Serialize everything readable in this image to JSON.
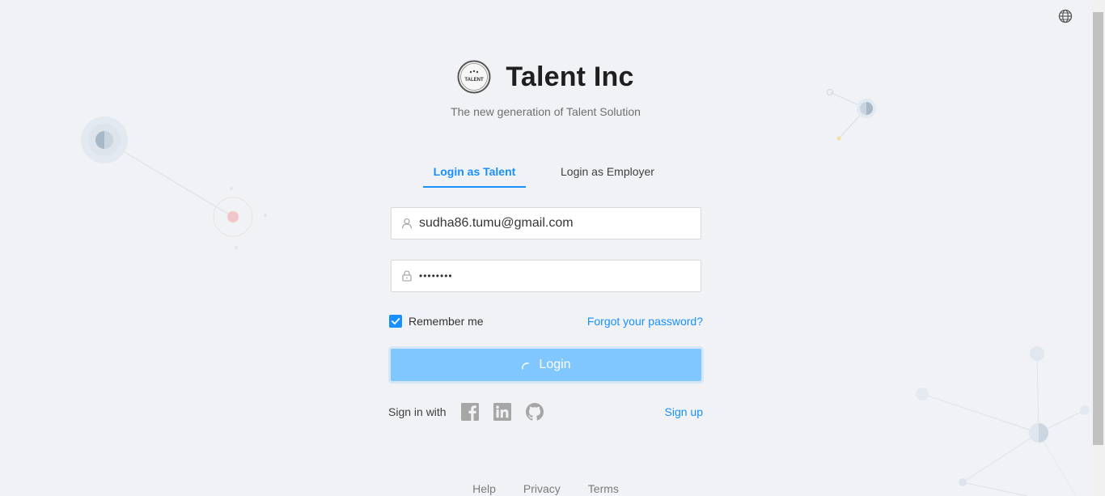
{
  "header": {
    "title": "Talent Inc",
    "subtitle": "The new generation of Talent Solution",
    "logo_text": "TALENT"
  },
  "tabs": [
    {
      "label": "Login as Talent",
      "active": true
    },
    {
      "label": "Login as Employer",
      "active": false
    }
  ],
  "form": {
    "username_value": "sudha86.tumu@gmail.com",
    "password_display": "••••••••",
    "remember_label": "Remember me",
    "remember_checked": true,
    "forgot_label": "Forgot your password?",
    "login_label": "Login",
    "login_state": "loading"
  },
  "social": {
    "sign_in_with_label": "Sign in with",
    "providers": [
      "facebook-icon",
      "linkedin-icon",
      "github-icon"
    ],
    "signup_label": "Sign up"
  },
  "footer": {
    "links": [
      "Help",
      "Privacy",
      "Terms"
    ]
  },
  "icons": {
    "language": "globe-icon",
    "username_prefix": "user-icon",
    "password_prefix": "lock-icon"
  },
  "colors": {
    "accent": "#1890ff",
    "button_loading": "#80c6ff",
    "background": "#f0f2f5"
  }
}
